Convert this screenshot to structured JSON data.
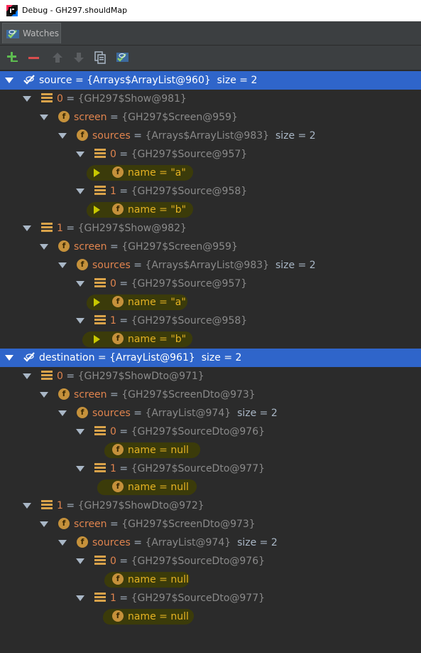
{
  "window": {
    "title": "Debug - GH297.shouldMap"
  },
  "tab": {
    "label": "Watches"
  },
  "toolbar": {
    "buttons": [
      "add-watch",
      "remove-watch",
      "move-up",
      "move-down",
      "copy",
      "show-watches"
    ]
  },
  "colors": {
    "selection": "#2f65ca",
    "highlight": "#3b3b0a",
    "field_icon": "#c5913b",
    "name": "#e0844e",
    "value": "#8a8a8a"
  },
  "rows": [
    {
      "name": "source",
      "eq": " = ",
      "value": "{Arrays$ArrayList@960}",
      "size": "size = 2"
    },
    {
      "name": "0",
      "eq": " = ",
      "value": "{GH297$Show@981}"
    },
    {
      "name": "screen",
      "eq": " = ",
      "value": "{GH297$Screen@959}"
    },
    {
      "name": "sources",
      "eq": " = ",
      "value": "{Arrays$ArrayList@983}",
      "size": "size = 2"
    },
    {
      "name": "0",
      "eq": " = ",
      "value": "{GH297$Source@957}"
    },
    {
      "name": "name",
      "eq": " = ",
      "value": "\"a\""
    },
    {
      "name": "1",
      "eq": " = ",
      "value": "{GH297$Source@958}"
    },
    {
      "name": "name",
      "eq": " = ",
      "value": "\"b\""
    },
    {
      "name": "1",
      "eq": " = ",
      "value": "{GH297$Show@982}"
    },
    {
      "name": "screen",
      "eq": " = ",
      "value": "{GH297$Screen@959}"
    },
    {
      "name": "sources",
      "eq": " = ",
      "value": "{Arrays$ArrayList@983}",
      "size": "size = 2"
    },
    {
      "name": "0",
      "eq": " = ",
      "value": "{GH297$Source@957}"
    },
    {
      "name": "name",
      "eq": " = ",
      "value": "\"a\""
    },
    {
      "name": "1",
      "eq": " = ",
      "value": "{GH297$Source@958}"
    },
    {
      "name": "name",
      "eq": " = ",
      "value": "\"b\""
    },
    {
      "name": "destination",
      "eq": " = ",
      "value": "{ArrayList@961}",
      "size": "size = 2"
    },
    {
      "name": "0",
      "eq": " = ",
      "value": "{GH297$ShowDto@971}"
    },
    {
      "name": "screen",
      "eq": " = ",
      "value": "{GH297$ScreenDto@973}"
    },
    {
      "name": "sources",
      "eq": " = ",
      "value": "{ArrayList@974}",
      "size": "size = 2"
    },
    {
      "name": "0",
      "eq": " = ",
      "value": "{GH297$SourceDto@976}"
    },
    {
      "name": "name",
      "eq": " = ",
      "value": "null"
    },
    {
      "name": "1",
      "eq": " = ",
      "value": "{GH297$SourceDto@977}"
    },
    {
      "name": "name",
      "eq": " = ",
      "value": "null"
    },
    {
      "name": "1",
      "eq": " = ",
      "value": "{GH297$ShowDto@972}"
    },
    {
      "name": "screen",
      "eq": " = ",
      "value": "{GH297$ScreenDto@973}"
    },
    {
      "name": "sources",
      "eq": " = ",
      "value": "{ArrayList@974}",
      "size": "size = 2"
    },
    {
      "name": "0",
      "eq": " = ",
      "value": "{GH297$SourceDto@976}"
    },
    {
      "name": "name",
      "eq": " = ",
      "value": "null"
    },
    {
      "name": "1",
      "eq": " = ",
      "value": "{GH297$SourceDto@977}"
    },
    {
      "name": "name",
      "eq": " = ",
      "value": "null"
    }
  ]
}
